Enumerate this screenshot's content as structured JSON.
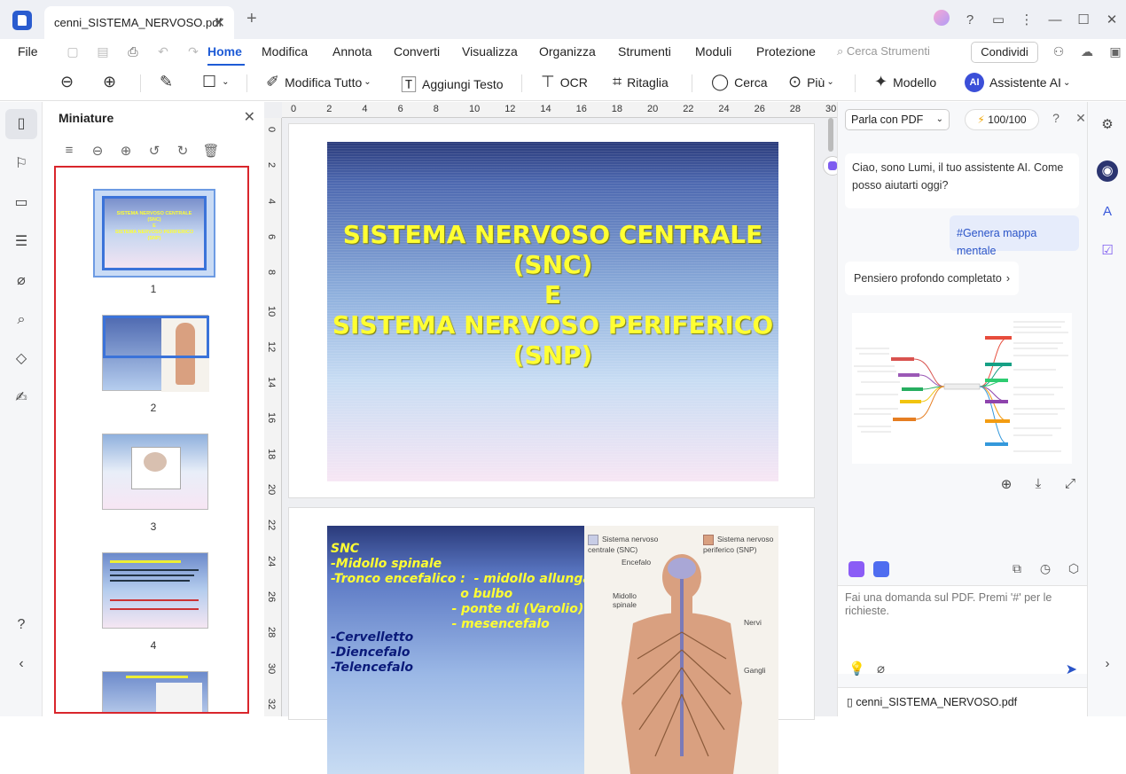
{
  "titlebar": {
    "tab_title": "cenni_SISTEMA_NERVOSO.pdf",
    "tab_close": "✕",
    "new_tab": "+"
  },
  "menubar": {
    "file": "File",
    "menus": [
      "Home",
      "Modifica",
      "Annota",
      "Converti",
      "Visualizza",
      "Organizza",
      "Strumenti",
      "Moduli",
      "Protezione"
    ],
    "active_menu": "Home",
    "search_placeholder": "Cerca Strumenti",
    "share": "Condividi"
  },
  "toolbar": {
    "edit_all": "Modifica Tutto",
    "add_text": "Aggiungi Testo",
    "ocr": "OCR",
    "crop": "Ritaglia",
    "search": "Cerca",
    "more": "Più",
    "template": "Modello",
    "ai_badge": "AI",
    "ai_assistant": "Assistente AI"
  },
  "thumbnails": {
    "title": "Miniature",
    "pages": [
      "1",
      "2",
      "3",
      "4"
    ],
    "selected_page": 1
  },
  "ruler": {
    "h_ticks": [
      "0",
      "2",
      "4",
      "6",
      "8",
      "10",
      "12",
      "14",
      "16",
      "18",
      "20",
      "22",
      "24",
      "26",
      "28",
      "30"
    ],
    "v_ticks": [
      "0",
      "2",
      "4",
      "6",
      "8",
      "10",
      "12",
      "14",
      "16",
      "18",
      "20",
      "22",
      "24",
      "26",
      "28",
      "30",
      "32"
    ]
  },
  "page1": {
    "lines": [
      "SISTEMA NERVOSO CENTRALE",
      "(SNC)",
      "E",
      "SISTEMA NERVOSO PERIFERICO",
      "(SNP)"
    ]
  },
  "page2": {
    "text_yellow": "SNC\n-Midollo spinale\n-Tronco encefalico :  - midollo allungato\n                              o bulbo\n                            - ponte di (Varolio)\n                            - mesencefalo",
    "text_blue": "-Cervelletto\n-Diencefalo\n-Telencefalo",
    "legend_snc": "Sistema nervoso centrale (SNC)",
    "legend_snp": "Sistema nervoso periferico (SNP)",
    "label_encefalo": "Encefalo",
    "label_midollo": "Midollo spinale",
    "label_nervi": "Nervi",
    "label_gangli": "Gangli"
  },
  "ai_panel": {
    "mode": "Parla con PDF",
    "credits": "100/100",
    "greeting": "Ciao, sono Lumi, il tuo assistente AI. Come posso aiutarti oggi?",
    "user_message": "#Genera mappa mentale",
    "thinking_done": "Pensiero profondo completato",
    "input_placeholder": "Fai una domanda sul PDF. Premi '#' per le richieste.",
    "file_name": "cenni_SISTEMA_NERVOSO.pdf"
  },
  "colors": {
    "accent": "#1e5bd6",
    "thumb_border": "#d9262c",
    "slide_text": "#ffff33"
  }
}
